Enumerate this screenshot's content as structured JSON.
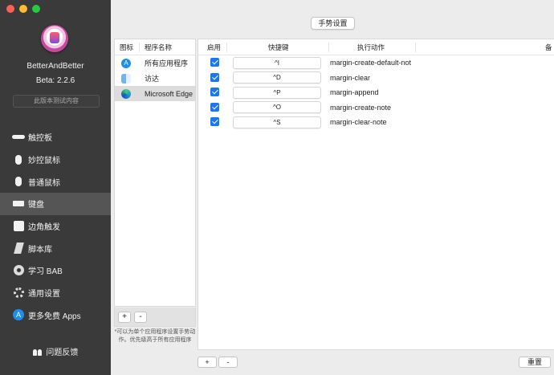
{
  "window": {
    "traffic_colors": [
      "#ff5f57",
      "#febc2e",
      "#28c840"
    ]
  },
  "sidebar": {
    "app_name": "BetterAndBetter",
    "version": "Beta: 2.2.6",
    "beta_button": "此版本测试内容",
    "items": [
      {
        "label": "触控板",
        "icon": "trackpad-icon"
      },
      {
        "label": "妙控鼠标",
        "icon": "magic-mouse-icon"
      },
      {
        "label": "普通鼠标",
        "icon": "mouse-icon"
      },
      {
        "label": "键盘",
        "icon": "keyboard-icon",
        "active": true
      },
      {
        "label": "边角触发",
        "icon": "corner-icon"
      },
      {
        "label": "脚本库",
        "icon": "script-icon"
      },
      {
        "label": "学习 BAB",
        "icon": "disc-icon"
      },
      {
        "label": "通用设置",
        "icon": "gear-icon"
      },
      {
        "label": "更多免费 Apps",
        "icon": "app-store-icon"
      }
    ],
    "feedback": "问题反馈"
  },
  "main": {
    "top_button": "手势设置",
    "app_list": {
      "headers": {
        "icon": "图标",
        "name": "程序名称"
      },
      "rows": [
        {
          "name": "所有应用程序",
          "icon": "app-store-icon"
        },
        {
          "name": "访达",
          "icon": "finder-icon"
        },
        {
          "name": "Microsoft Edge",
          "icon": "edge-icon",
          "selected": true
        }
      ],
      "add": "+",
      "remove": "-",
      "note": "*可以为单个应用程序设置手势动作。优先级高于所有应用程序"
    },
    "shortcuts": {
      "headers": {
        "enabled": "启用",
        "shortcut": "快捷键",
        "action": "执行动作",
        "notes": "备"
      },
      "rows": [
        {
          "enabled": true,
          "shortcut": "^I",
          "action": "margin-create-default-not"
        },
        {
          "enabled": true,
          "shortcut": "^D",
          "action": "margin-clear"
        },
        {
          "enabled": true,
          "shortcut": "^P",
          "action": "margin-append"
        },
        {
          "enabled": true,
          "shortcut": "^O",
          "action": "margin-create-note"
        },
        {
          "enabled": true,
          "shortcut": "^S",
          "action": "margin-clear-note"
        }
      ],
      "add": "+",
      "remove": "-",
      "reset": "重置"
    }
  }
}
